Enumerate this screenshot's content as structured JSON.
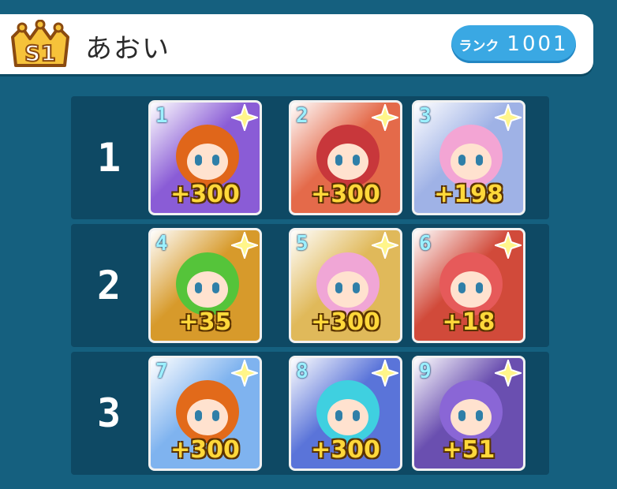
{
  "header": {
    "badge_text": "S1",
    "player_name": "あおい",
    "rank_label": "ランク",
    "rank_value": "1001"
  },
  "colors": {
    "background": "#15607f",
    "row_background": "#0e4964",
    "level_text": "#ffd83a",
    "rank_pill": "#3aa8e3"
  },
  "rows": [
    {
      "label": "1",
      "cards": [
        {
          "slot": "1",
          "level": "+300",
          "frame": "#8a5cd6",
          "hair": "#e0661a",
          "icon": "character-portrait-icon"
        },
        {
          "slot": "2",
          "level": "+300",
          "frame": "#e46a4a",
          "hair": "#c8373b",
          "icon": "character-portrait-icon"
        },
        {
          "slot": "3",
          "level": "+198",
          "frame": "#9fb2e6",
          "hair": "#f3a5d4",
          "icon": "character-portrait-icon"
        }
      ]
    },
    {
      "label": "2",
      "cards": [
        {
          "slot": "4",
          "level": "+35",
          "frame": "#d79a2b",
          "hair": "#55c43a",
          "icon": "character-portrait-icon"
        },
        {
          "slot": "5",
          "level": "+300",
          "frame": "#e0b95a",
          "hair": "#f0a6d6",
          "icon": "character-portrait-icon"
        },
        {
          "slot": "6",
          "level": "+18",
          "frame": "#d14a3a",
          "hair": "#e65a5a",
          "icon": "character-portrait-icon"
        }
      ]
    },
    {
      "label": "3",
      "cards": [
        {
          "slot": "7",
          "level": "+300",
          "frame": "#7fb3ef",
          "hair": "#e26a1a",
          "icon": "character-portrait-icon"
        },
        {
          "slot": "8",
          "level": "+300",
          "frame": "#5a74d9",
          "hair": "#3fd0e0",
          "icon": "character-portrait-icon"
        },
        {
          "slot": "9",
          "level": "+51",
          "frame": "#6a4fb0",
          "hair": "#8a66d6",
          "icon": "character-portrait-icon"
        }
      ]
    }
  ]
}
